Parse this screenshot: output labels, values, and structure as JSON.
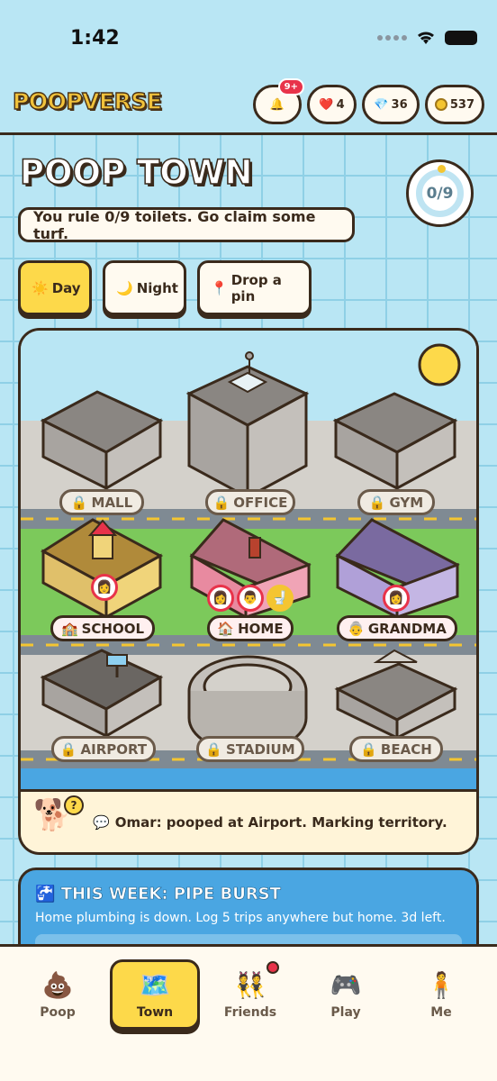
{
  "status": {
    "time": "1:42"
  },
  "header": {
    "app_title": "POOPVERSE",
    "notifications_badge": "9+",
    "hearts": "4",
    "gems": "36",
    "coins": "537"
  },
  "town": {
    "title": "POOP TOWN",
    "progress": "0/9",
    "subtitle": "You rule 0/9 toilets. Go claim some turf."
  },
  "modes": [
    {
      "label": "Day",
      "icon": "sun-icon"
    },
    {
      "label": "Night",
      "icon": "moon-icon"
    },
    {
      "label": "Drop a pin",
      "icon": "pin-icon"
    }
  ],
  "locations": [
    {
      "label": "MALL",
      "locked": true
    },
    {
      "label": "OFFICE",
      "locked": true
    },
    {
      "label": "GYM",
      "locked": true
    },
    {
      "label": "SCHOOL",
      "locked": false
    },
    {
      "label": "HOME",
      "locked": false
    },
    {
      "label": "GRANDMA",
      "locked": false
    },
    {
      "label": "AIRPORT",
      "locked": true
    },
    {
      "label": "STADIUM",
      "locked": true
    },
    {
      "label": "BEACH",
      "locked": true
    }
  ],
  "feed": {
    "message": "Omar: pooped at Airport. Marking territory."
  },
  "event": {
    "title": "THIS WEEK: PIPE BURST",
    "description": "Home plumbing is down. Log 5 trips anywhere but home. 3d left."
  },
  "tabs": [
    {
      "label": "Poop",
      "icon": "poop-icon"
    },
    {
      "label": "Town",
      "icon": "map-icon"
    },
    {
      "label": "Friends",
      "icon": "friends-icon"
    },
    {
      "label": "Play",
      "icon": "gamepad-icon"
    },
    {
      "label": "Me",
      "icon": "profile-icon"
    }
  ],
  "colors": {
    "background": "#b9e6f4",
    "accent_yellow": "#fdd94a",
    "outline": "#3a2a1c",
    "event_blue": "#4aa6e2",
    "alert_red": "#e8334a"
  }
}
